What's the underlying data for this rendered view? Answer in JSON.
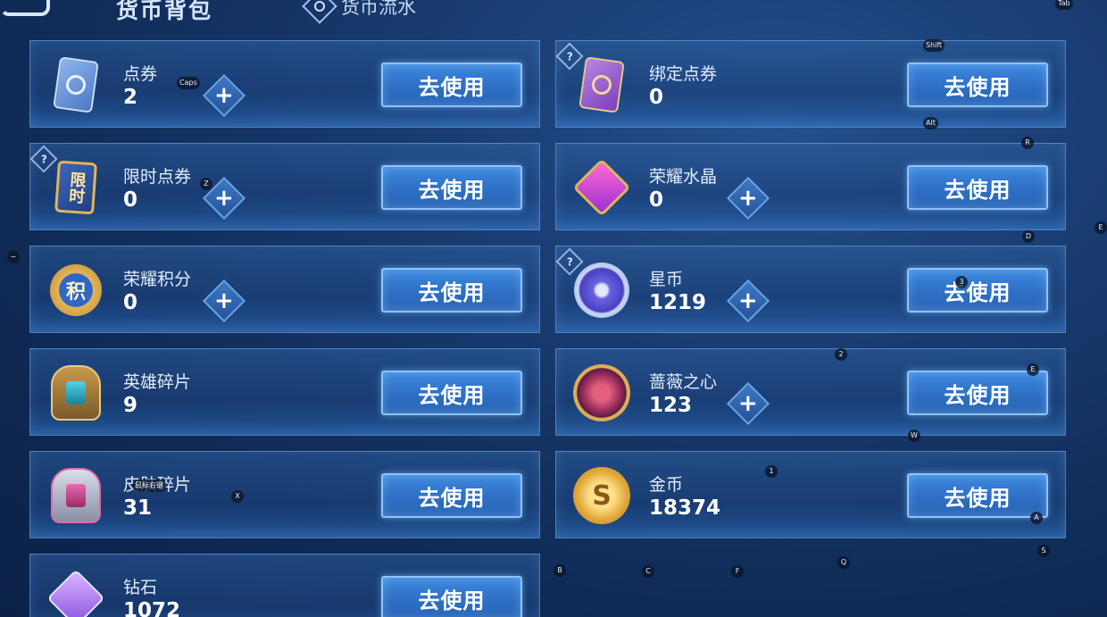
{
  "header": {
    "title": "货币背包",
    "flow_label": "货币流水"
  },
  "button_label": "去使用",
  "plus_glyph": "+",
  "help_glyph": "?",
  "currencies": [
    {
      "name": "点券",
      "value": "2",
      "icon": "ticket-icon"
    },
    {
      "name": "绑定点券",
      "value": "0",
      "icon": "bound-ticket-icon"
    },
    {
      "name": "限时点券",
      "value": "0",
      "icon": "limited-ticket-icon",
      "badge_text": "限时"
    },
    {
      "name": "荣耀水晶",
      "value": "0",
      "icon": "glory-crystal-icon"
    },
    {
      "name": "荣耀积分",
      "value": "0",
      "icon": "glory-points-icon",
      "badge_text": "积"
    },
    {
      "name": "星币",
      "value": "1219",
      "icon": "star-coin-icon"
    },
    {
      "name": "英雄碎片",
      "value": "9",
      "icon": "hero-fragment-icon"
    },
    {
      "name": "蔷薇之心",
      "value": "123",
      "icon": "rose-heart-icon"
    },
    {
      "name": "皮肤碎片",
      "value": "31",
      "icon": "skin-fragment-icon"
    },
    {
      "name": "金币",
      "value": "18374",
      "icon": "gold-coin-icon"
    },
    {
      "name": "钻石",
      "value": "1072",
      "icon": "diamond-icon"
    }
  ],
  "key_hints": [
    "Tab",
    "Shift",
    "Alt",
    "Caps",
    "Z",
    "R",
    "D",
    "E",
    "~",
    "3",
    "2",
    "E",
    "W",
    "1",
    "X",
    "鼠标右键",
    "A",
    "S",
    "B",
    "C",
    "F",
    "Q"
  ],
  "colors": {
    "accent_blue": "#3f8ae0",
    "gold": "#e2b45a",
    "purple": "#9b5bd6"
  }
}
